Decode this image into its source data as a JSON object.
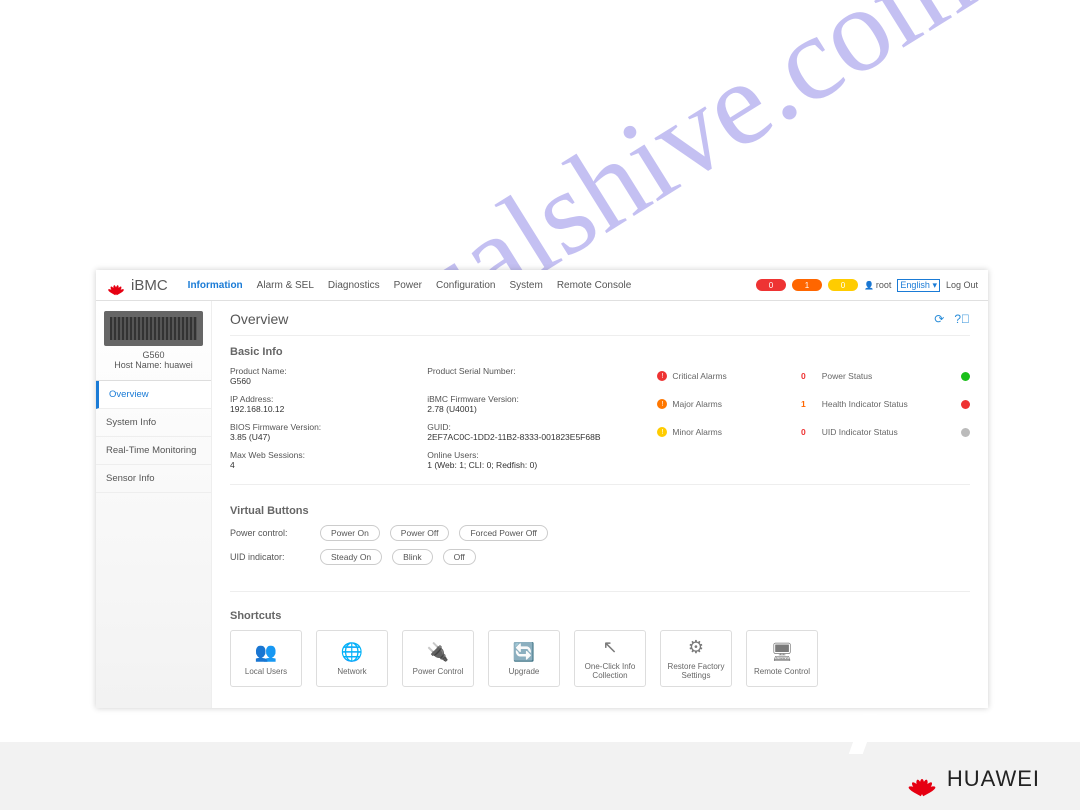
{
  "brand": "iBMC",
  "tabs": [
    "Information",
    "Alarm & SEL",
    "Diagnostics",
    "Power",
    "Configuration",
    "System",
    "Remote Console"
  ],
  "active_tab": 0,
  "pills": {
    "red": "0",
    "orange": "1",
    "yellow": "0"
  },
  "user": "root",
  "lang": "English ▾",
  "logout": "Log Out",
  "sidebar": {
    "model": "G560",
    "hostname_label": "Host Name: huawei",
    "items": [
      "Overview",
      "System Info",
      "Real-Time Monitoring",
      "Sensor Info"
    ],
    "active": 0
  },
  "page_title": "Overview",
  "sections": {
    "basic": "Basic Info",
    "vb": "Virtual Buttons",
    "sc": "Shortcuts"
  },
  "basic": {
    "r1": {
      "k1": "Product Name:",
      "v1": "G560",
      "k2": "Product Serial Number:",
      "v2": ""
    },
    "r2": {
      "k1": "IP Address:",
      "v1": "192.168.10.12",
      "k2": "iBMC Firmware Version:",
      "v2": "2.78 (U4001)"
    },
    "r3": {
      "k1": "BIOS Firmware Version:",
      "v1": "3.85 (U47)",
      "k2": "GUID:",
      "v2": "2EF7AC0C-1DD2-11B2-8333-001823E5F68B"
    },
    "r4": {
      "k1": "Max Web Sessions:",
      "v1": "4",
      "k2": "Online Users:",
      "v2": "1 (Web: 1; CLI: 0; Redfish: 0)"
    }
  },
  "alarms": {
    "crit": {
      "label": "Critical Alarms",
      "count": "0"
    },
    "major": {
      "label": "Major Alarms",
      "count": "1"
    },
    "minor": {
      "label": "Minor Alarms",
      "count": "0"
    }
  },
  "statuses": {
    "power": {
      "label": "Power Status"
    },
    "health": {
      "label": "Health Indicator Status"
    },
    "uid": {
      "label": "UID Indicator Status"
    }
  },
  "vb": {
    "power_label": "Power control:",
    "power_btns": [
      "Power On",
      "Power Off",
      "Forced Power Off"
    ],
    "uid_label": "UID indicator:",
    "uid_btns": [
      "Steady On",
      "Blink",
      "Off"
    ]
  },
  "shortcuts": [
    {
      "icon": "👥",
      "label": "Local Users"
    },
    {
      "icon": "🌐",
      "label": "Network"
    },
    {
      "icon": "🔌",
      "label": "Power Control"
    },
    {
      "icon": "🔄",
      "label": "Upgrade"
    },
    {
      "icon": "↖",
      "label": "One-Click Info Collection"
    },
    {
      "icon": "⚙",
      "label": "Restore Factory Settings"
    },
    {
      "icon": "🖥",
      "label": "Remote Control"
    }
  ],
  "footer_brand": "HUAWEI",
  "watermark": "manualshive.com"
}
